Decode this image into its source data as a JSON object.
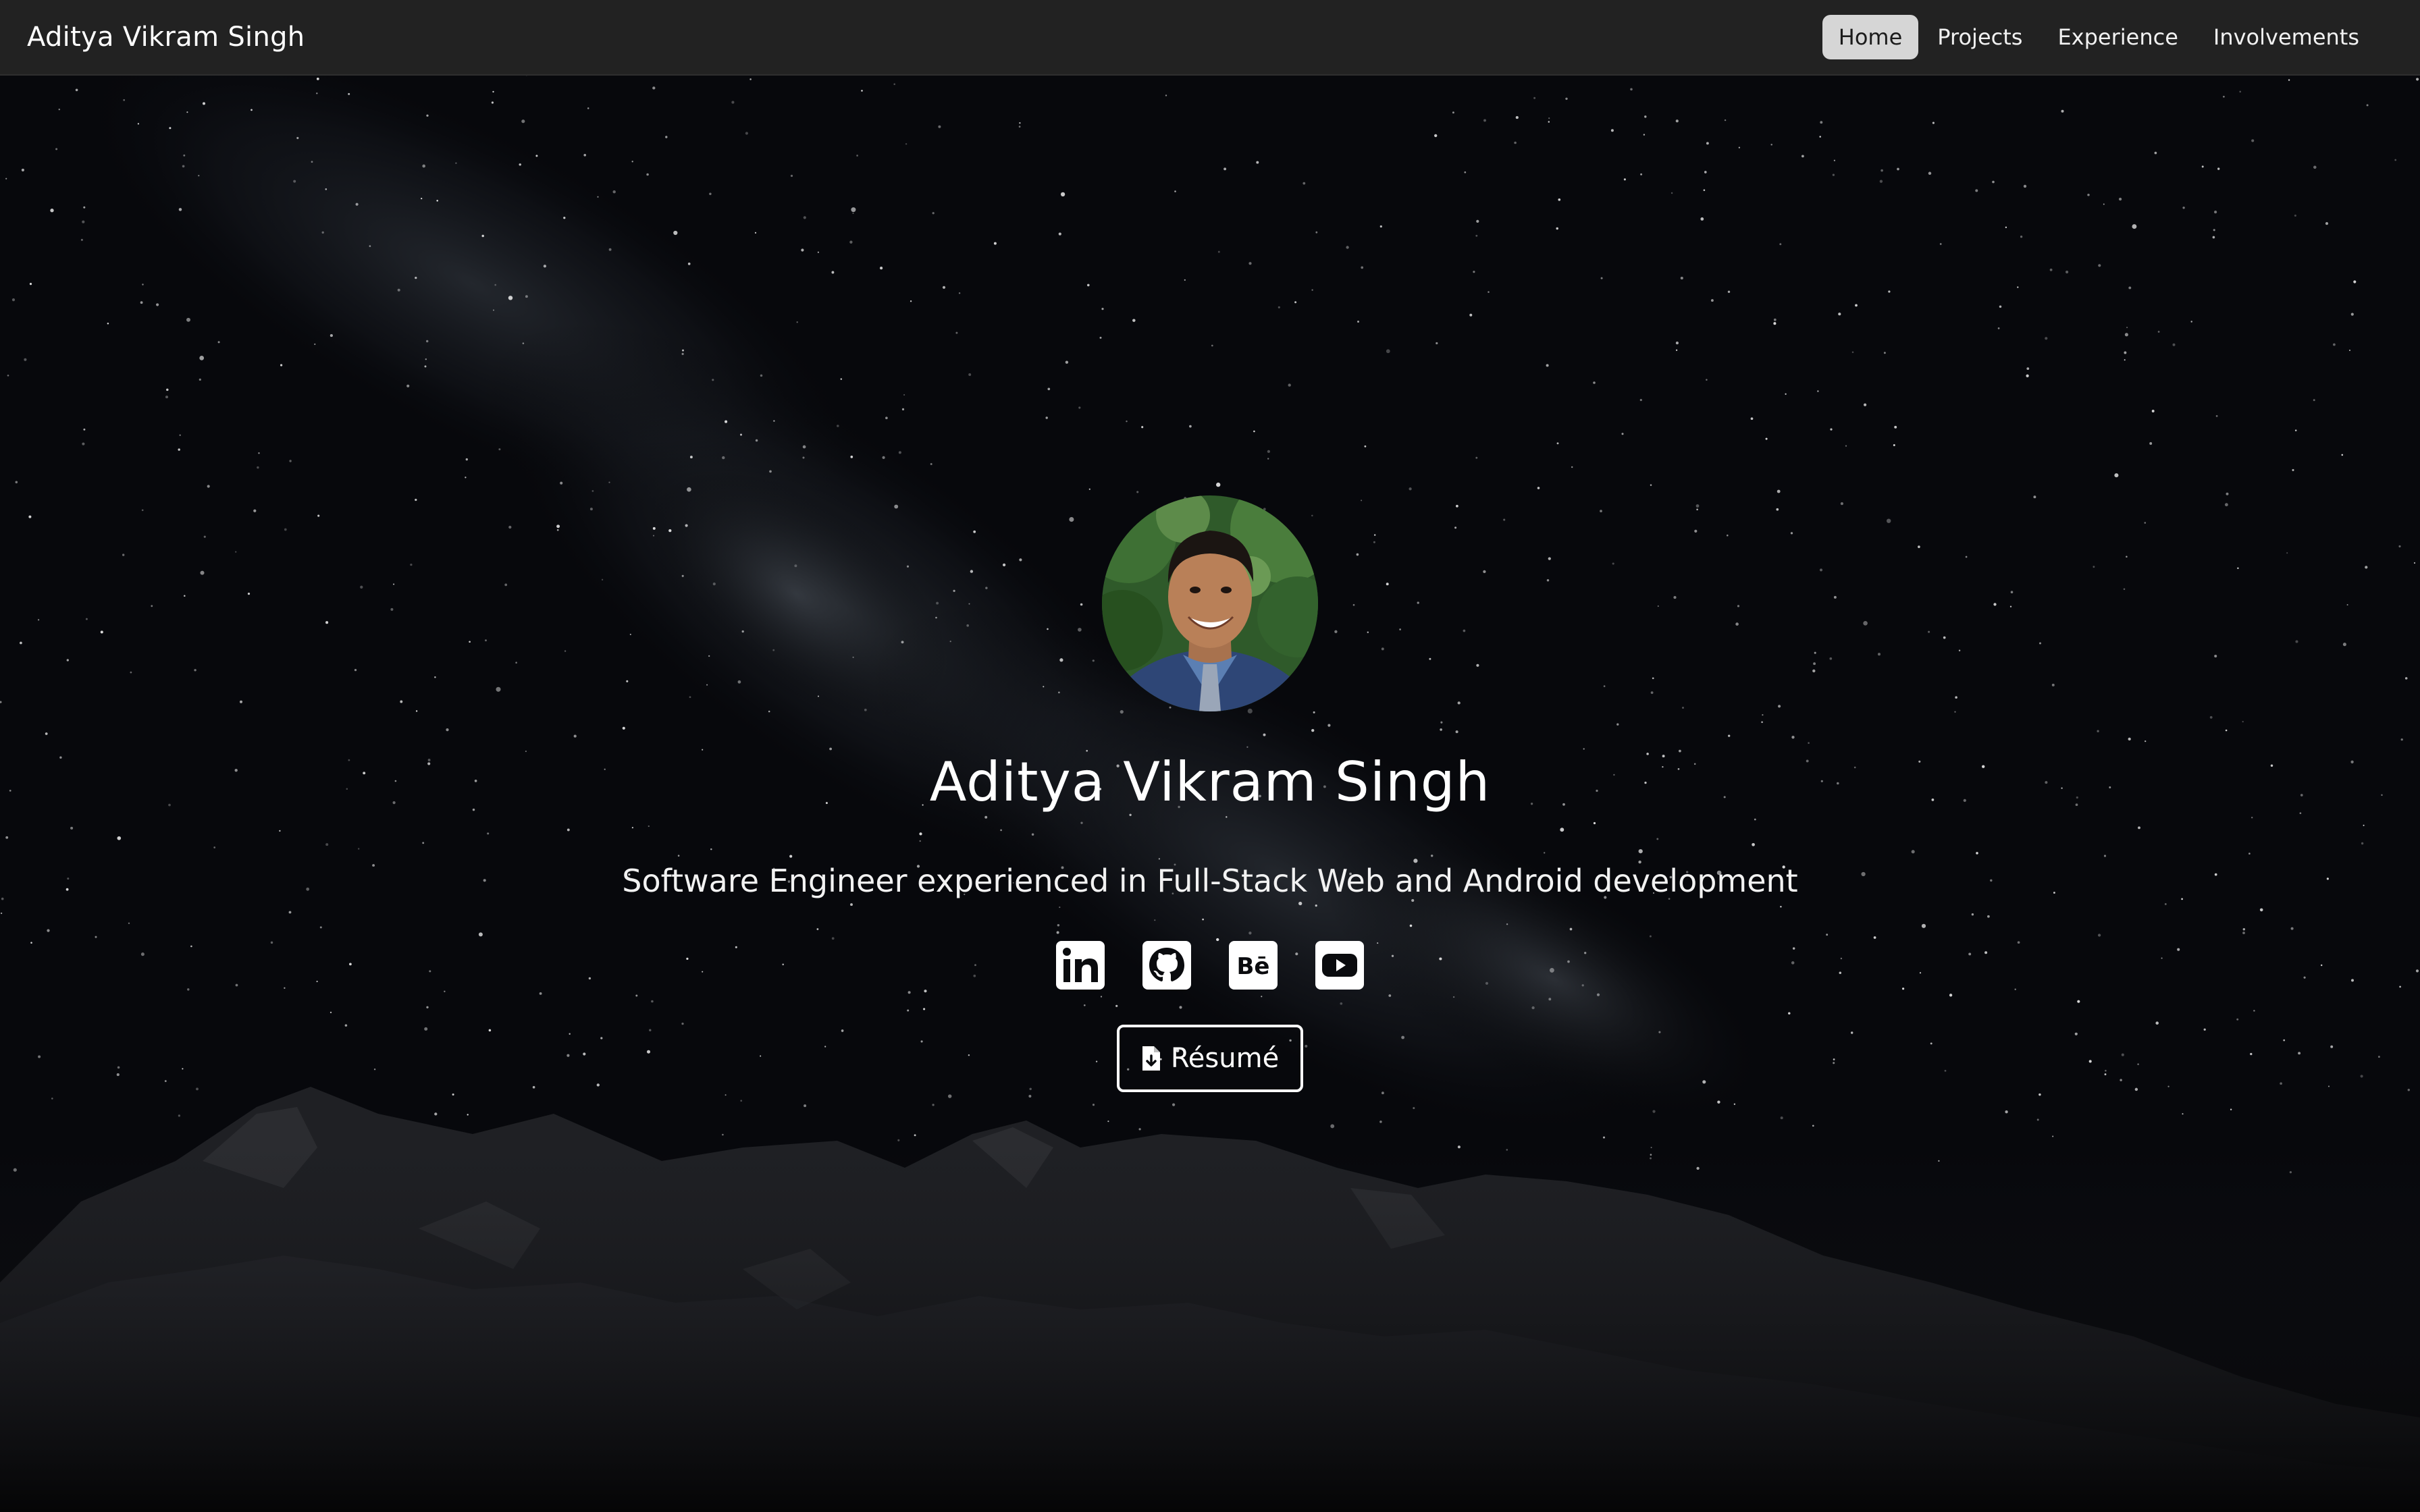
{
  "navbar": {
    "brand": "Aditya Vikram Singh",
    "links": [
      {
        "label": "Home",
        "active": true
      },
      {
        "label": "Projects",
        "active": false
      },
      {
        "label": "Experience",
        "active": false
      },
      {
        "label": "Involvements",
        "active": false
      }
    ]
  },
  "hero": {
    "name": "Aditya Vikram Singh",
    "tagline": "Software Engineer experienced in Full-Stack Web and Android development",
    "avatar_icon": "profile-photo",
    "socials": [
      {
        "name": "linkedin-icon"
      },
      {
        "name": "github-icon"
      },
      {
        "name": "behance-icon"
      },
      {
        "name": "youtube-icon"
      }
    ],
    "resume_label": "Résumé",
    "resume_icon": "file-download-icon"
  },
  "colors": {
    "navbar_bg": "#222222",
    "active_tab_bg": "#d6d6d6",
    "page_bg": "#07080c",
    "text": "#ffffff"
  }
}
